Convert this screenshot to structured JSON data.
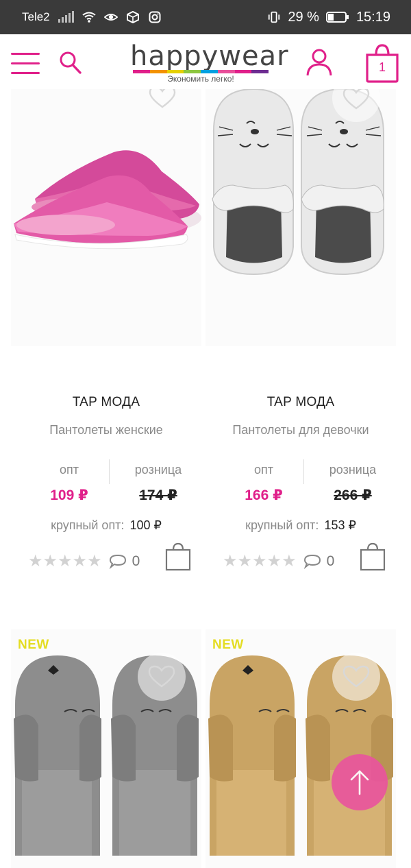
{
  "status_bar": {
    "carrier": "Tele2",
    "battery": "29 %",
    "time": "15:19"
  },
  "header": {
    "logo_text": "happywear",
    "tagline": "Экономить легко!",
    "cart_count": "1",
    "logo_colors": [
      "#e0208a",
      "#f39200",
      "#e6d000",
      "#8dc63f",
      "#00a0e0",
      "#e84f9a",
      "#e0208a",
      "#6d2d91"
    ]
  },
  "labels": {
    "opt": "опт",
    "retail": "розница",
    "bulk": "крупный опт:"
  },
  "products": [
    {
      "brand": "TAP МОДА",
      "name": "Пантолеты женские",
      "opt_price": "109 ₽",
      "retail_price": "174 ₽",
      "bulk_price": "100 ₽",
      "comments": "0"
    },
    {
      "brand": "TAP МОДА",
      "name": "Пантолеты для девочки",
      "opt_price": "166 ₽",
      "retail_price": "266 ₽",
      "bulk_price": "153 ₽",
      "comments": "0"
    },
    {
      "badge": "NEW"
    },
    {
      "badge": "NEW"
    }
  ],
  "colors": {
    "accent": "#e0208a",
    "scroll_button": "#e9559d",
    "new_badge": "#e4dd22"
  },
  "icons": [
    "menu-icon",
    "search-icon",
    "user-icon",
    "cart-icon",
    "heart-icon",
    "star-icon",
    "comment-icon",
    "bag-icon",
    "arrow-up-icon"
  ]
}
